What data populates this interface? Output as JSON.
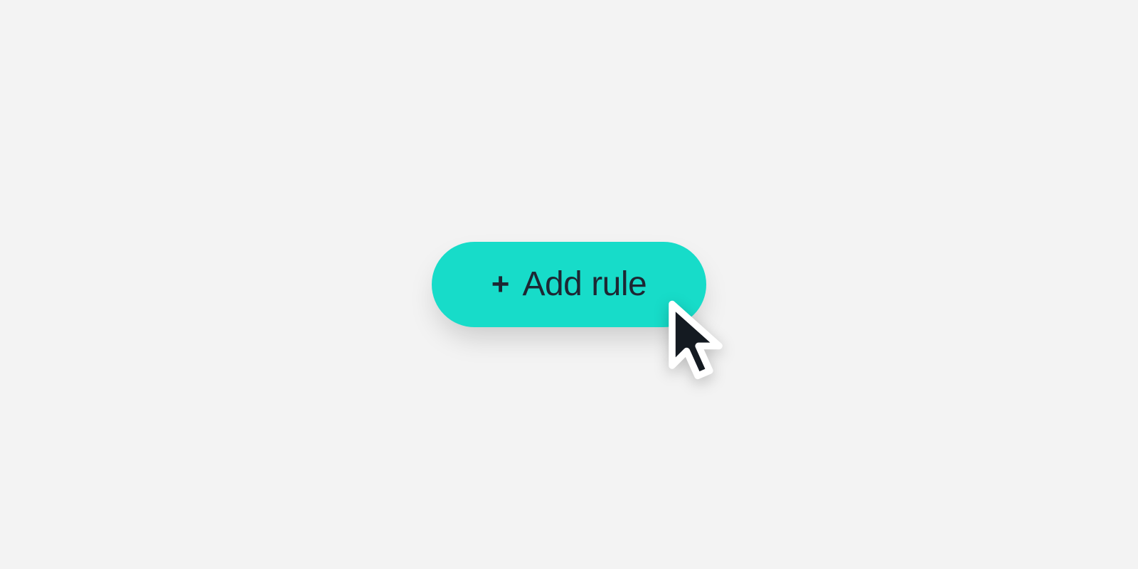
{
  "button": {
    "label": "Add rule",
    "plus_symbol": "+"
  },
  "colors": {
    "button_bg": "#17dcc9",
    "text": "#1d2733",
    "page_bg": "#f3f3f3"
  }
}
